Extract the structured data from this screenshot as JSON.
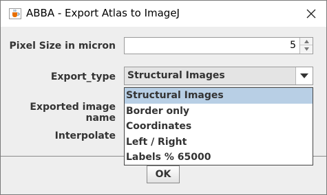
{
  "window": {
    "title": "ABBA - Export Atlas to ImageJ"
  },
  "form": {
    "pixel_size_label": "Pixel Size in micron",
    "pixel_size_value": "5",
    "export_type_label": "Export_type",
    "export_type_value": "Structural Images",
    "exported_name_label": "Exported image name",
    "interpolate_label": "Interpolate"
  },
  "dropdown": {
    "items": [
      {
        "label": "Structural Images",
        "selected": true
      },
      {
        "label": "Border only",
        "selected": false
      },
      {
        "label": "Coordinates",
        "selected": false
      },
      {
        "label": "Left / Right",
        "selected": false
      },
      {
        "label": "Labels % 65000",
        "selected": false
      }
    ]
  },
  "buttons": {
    "ok_label": "OK"
  },
  "colors": {
    "selection": "#b8cfe5",
    "background": "#eeeeee"
  },
  "icons": {
    "app": "java-cup-icon",
    "close": "close-icon",
    "spin_up": "chevron-up-icon",
    "spin_down": "chevron-down-icon",
    "combo_arrow": "triangle-down-icon"
  }
}
